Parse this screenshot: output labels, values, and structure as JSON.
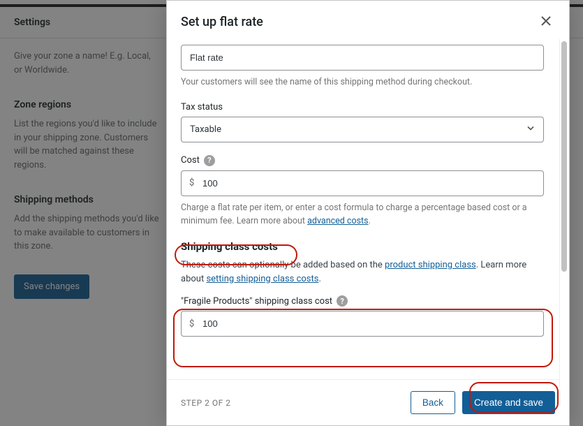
{
  "background": {
    "settings_header": "Settings",
    "zone_name_hint": "Give your zone a name! E.g. Local, or Worldwide.",
    "zone_regions_title": "Zone regions",
    "zone_regions_hint": "List the regions you'd like to include in your shipping zone. Customers will be matched against these regions.",
    "shipping_methods_title": "Shipping methods",
    "shipping_methods_hint": "Add the shipping methods you'd like to make available to customers in this zone.",
    "save_btn": "Save changes"
  },
  "modal": {
    "title": "Set up flat rate",
    "method_name": {
      "value": "Flat rate",
      "hint": "Your customers will see the name of this shipping method during checkout."
    },
    "tax_status": {
      "label": "Tax status",
      "value": "Taxable"
    },
    "cost": {
      "label": "Cost",
      "currency": "$",
      "value": "100",
      "hint_pre": "Charge a flat rate per item, or enter a cost formula to charge a percentage based cost or a minimum fee. Learn more about ",
      "hint_link": "advanced costs",
      "hint_post": "."
    },
    "shipping_class": {
      "heading": "Shipping class costs",
      "desc_pre": "These costs can optionally be added based on the ",
      "desc_link1": "product shipping class",
      "desc_mid": ". Learn more about ",
      "desc_link2": "setting shipping class costs",
      "desc_post": ".",
      "field_label": "\"Fragile Products\" shipping class cost",
      "currency": "$",
      "value": "100"
    },
    "footer": {
      "step": "STEP 2 OF 2",
      "back": "Back",
      "primary": "Create and save"
    }
  }
}
